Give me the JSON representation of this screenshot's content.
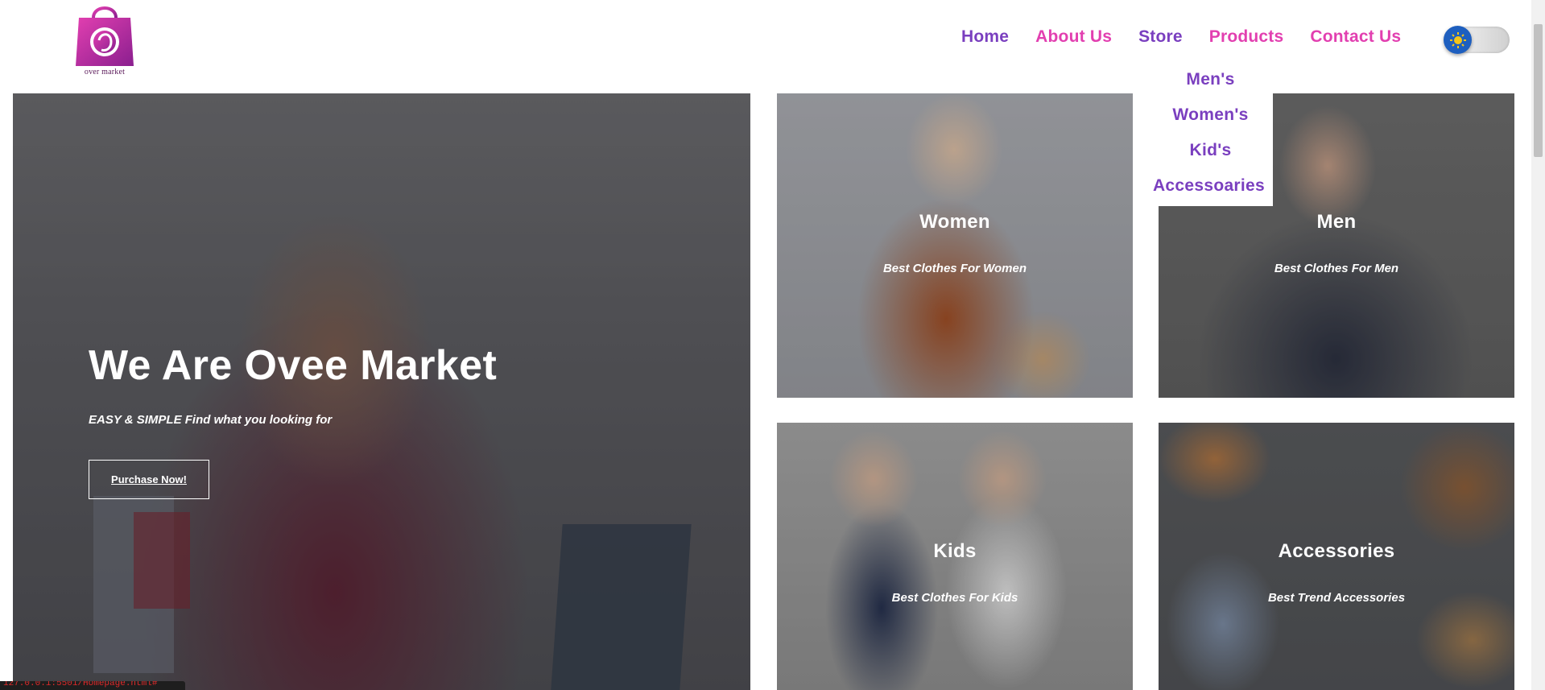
{
  "header": {
    "logo_text": "over market",
    "nav": [
      {
        "label": "Home",
        "color": "#7a3fbf"
      },
      {
        "label": "About Us",
        "color": "#e23fb0"
      },
      {
        "label": "Store",
        "color": "#7a3fbf"
      },
      {
        "label": "Products",
        "color": "#e23fb0"
      },
      {
        "label": "Contact Us",
        "color": "#e23fb0"
      }
    ],
    "theme_toggle_icon": "sun-icon"
  },
  "dropdown": {
    "items": [
      "Men's",
      "Women's",
      "Kid's",
      "Accessoaries"
    ]
  },
  "hero": {
    "title": "We Are Ovee Market",
    "subtitle": "EASY & SIMPLE Find what you looking for",
    "button": "Purchase Now!"
  },
  "cards": [
    {
      "title": "Women",
      "subtitle": "Best Clothes For Women"
    },
    {
      "title": "Men",
      "subtitle": "Best Clothes For Men"
    },
    {
      "title": "Kids",
      "subtitle": "Best Clothes For Kids"
    },
    {
      "title": "Accessories",
      "subtitle": "Best Trend Accessories"
    }
  ],
  "status_bar": {
    "url": "127.0.0.1:5501/Homepage.html#"
  },
  "colors": {
    "accent_purple": "#7a3fbf",
    "accent_pink": "#e23fb0",
    "toggle_blue": "#1e5fbf"
  }
}
